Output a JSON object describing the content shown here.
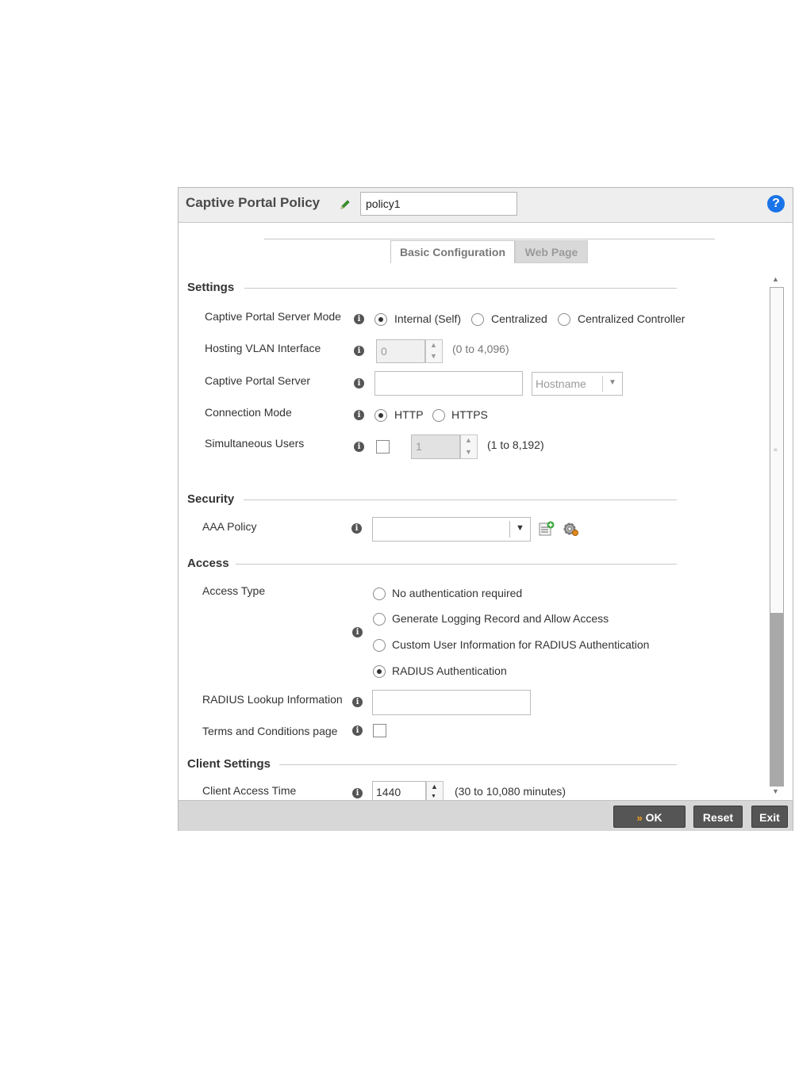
{
  "header": {
    "title": "Captive Portal Policy",
    "policy_name": "policy1"
  },
  "tabs": [
    {
      "label": "Basic Configuration",
      "active": true
    },
    {
      "label": "Web Page",
      "active": false
    }
  ],
  "settings": {
    "section_title": "Settings",
    "server_mode": {
      "label": "Captive Portal Server Mode",
      "options": [
        "Internal (Self)",
        "Centralized",
        "Centralized Controller"
      ],
      "selected": "Internal (Self)"
    },
    "hosting_vlan": {
      "label": "Hosting VLAN Interface",
      "value": "0",
      "range": "(0 to 4,096)"
    },
    "portal_server": {
      "label": "Captive Portal Server",
      "value": "",
      "type": "Hostname"
    },
    "connection_mode": {
      "label": "Connection Mode",
      "options": [
        "HTTP",
        "HTTPS"
      ],
      "selected": "HTTP"
    },
    "simultaneous_users": {
      "label": "Simultaneous Users",
      "checked": false,
      "value": "1",
      "range": "(1 to 8,192)"
    }
  },
  "security": {
    "section_title": "Security",
    "aaa_policy": {
      "label": "AAA Policy",
      "value": ""
    }
  },
  "access": {
    "section_title": "Access",
    "access_type": {
      "label": "Access Type",
      "options": [
        "No authentication required",
        "Generate Logging Record and Allow Access",
        "Custom User Information for RADIUS Authentication",
        "RADIUS Authentication"
      ],
      "selected": "RADIUS Authentication"
    },
    "radius_lookup": {
      "label": "RADIUS Lookup Information",
      "value": ""
    },
    "terms": {
      "label": "Terms and Conditions page",
      "checked": false
    }
  },
  "client_settings": {
    "section_title": "Client Settings",
    "access_time": {
      "label": "Client Access Time",
      "value": "1440",
      "range": "(30 to 10,080 minutes)"
    }
  },
  "footer": {
    "ok": "OK",
    "reset": "Reset",
    "exit": "Exit"
  },
  "colors": {
    "button": "#555555",
    "help": "#1a73e8",
    "header_bg": "#eeeeee",
    "footer_bg": "#d7d7d7"
  }
}
